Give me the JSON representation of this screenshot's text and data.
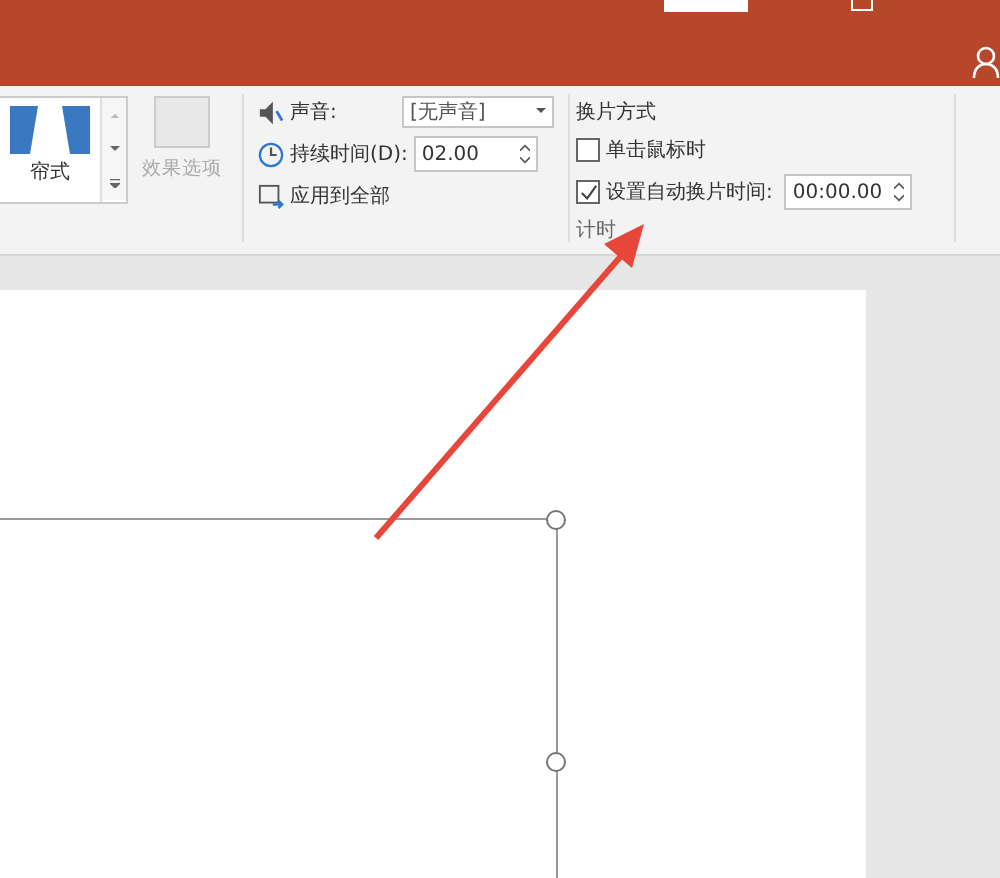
{
  "gallery": {
    "items": [
      {
        "label": "帘式",
        "selected": true
      }
    ]
  },
  "effect_options": {
    "label": "效果选项",
    "disabled": true
  },
  "timing": {
    "sound": {
      "label": "声音:",
      "value": "[无声音]"
    },
    "duration": {
      "label": "持续时间(D):",
      "value": "02.00"
    },
    "apply_all": {
      "label": "应用到全部"
    },
    "advance": {
      "title": "换片方式",
      "options": [
        {
          "label": "单击鼠标时",
          "checked": false
        },
        {
          "label": "设置自动换片时间:",
          "checked": true
        }
      ],
      "time": "00:00.00"
    },
    "group_label": "计时"
  }
}
